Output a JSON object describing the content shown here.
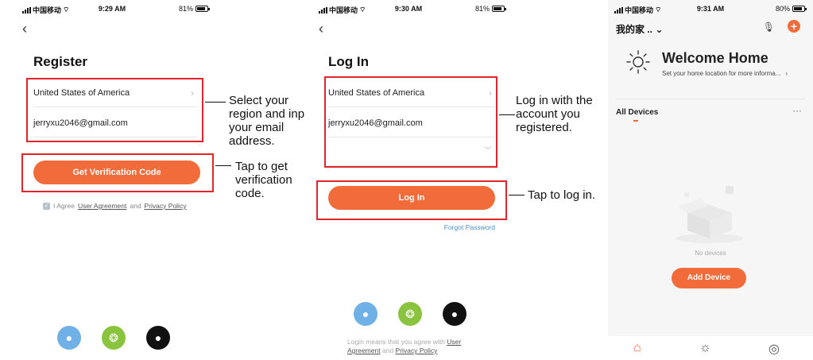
{
  "phone1": {
    "status": {
      "carrier": "中国移动",
      "time": "9:29 AM",
      "battery": "81%",
      "battery_level": 0.81
    },
    "title": "Register",
    "region": "United States of America",
    "email": "jerryxu2046@gmail.com",
    "button": "Get Verification Code",
    "agree": {
      "prefix": "I Agree",
      "link1": "User Agreement",
      "and": "and",
      "link2": "Privacy Policy"
    }
  },
  "phone2": {
    "status": {
      "carrier": "中国移动",
      "time": "9:30 AM",
      "battery": "81%",
      "battery_level": 0.81
    },
    "title": "Log In",
    "region": "United States of America",
    "email": "jerryxu2046@gmail.com",
    "button": "Log In",
    "forgot": "Forgot Password",
    "legal": {
      "prefix": "Login means that you agree with",
      "link1": "User Agreement",
      "and": "and",
      "link2": "Privacy Policy"
    }
  },
  "phone3": {
    "status": {
      "carrier": "中国移动",
      "time": "9:31 AM",
      "battery": "80%",
      "battery_level": 0.8
    },
    "home_name": "我的家 ..",
    "welcome": "Welcome Home",
    "welcome_sub": "Set your home location for more informa...",
    "all_devices": "All Devices",
    "no_devices": "No devices",
    "add_device": "Add Device"
  },
  "callouts": {
    "register_fields": "Select your region and input your email address.",
    "register_button": "Tap to get verification code.",
    "login_fields": "Log in with the account you registered.",
    "login_button": "Tap to log in."
  },
  "colors": {
    "accent": "#f26b3a",
    "highlight": "#e0252f",
    "link": "#4a90c8",
    "qq": "#6fb0e6",
    "wechat": "#8ac43f",
    "apple": "#111111"
  },
  "icons": [
    "back-chevron-icon",
    "chevron-right-icon",
    "eye-closed-icon",
    "qq-icon",
    "wechat-icon",
    "apple-icon",
    "mic-icon",
    "plus-icon",
    "sun-icon",
    "home-icon",
    "scene-icon",
    "profile-icon",
    "empty-box-icon"
  ]
}
